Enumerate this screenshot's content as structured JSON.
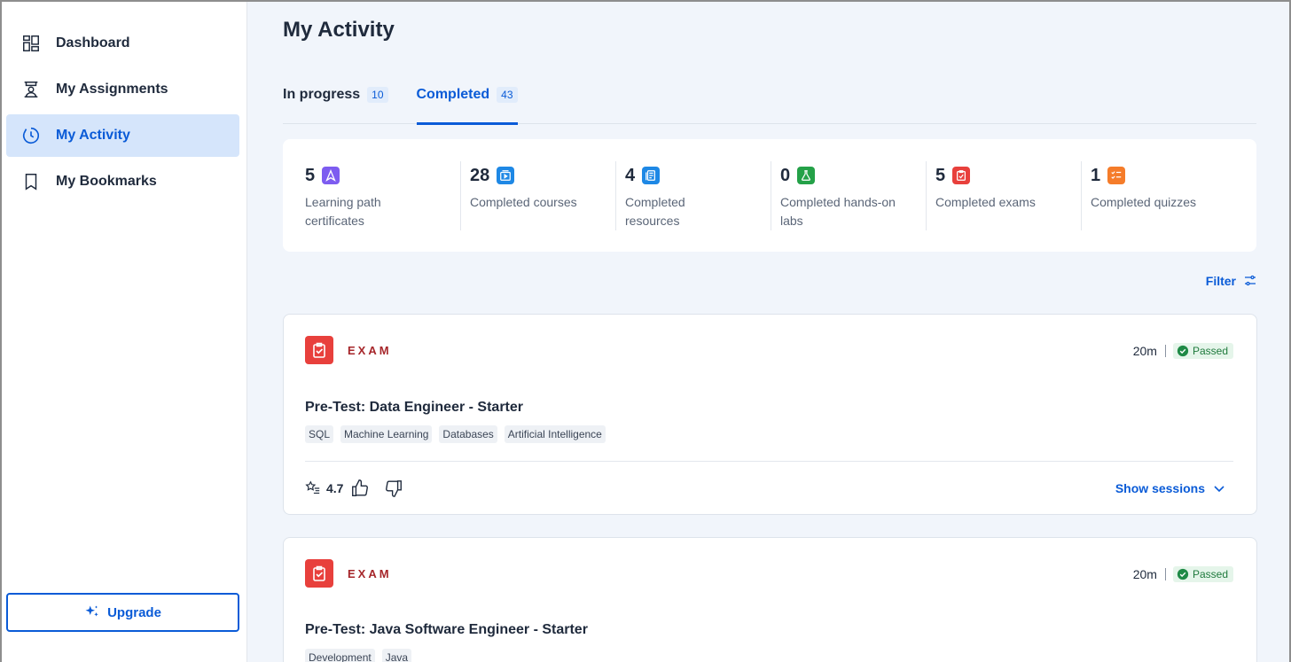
{
  "sidebar": {
    "items": [
      {
        "label": "Dashboard",
        "icon": "dashboard-icon",
        "active": false
      },
      {
        "label": "My Assignments",
        "icon": "assignments-icon",
        "active": false
      },
      {
        "label": "My Activity",
        "icon": "activity-icon",
        "active": true
      },
      {
        "label": "My Bookmarks",
        "icon": "bookmark-icon",
        "active": false
      }
    ],
    "upgrade_label": "Upgrade"
  },
  "main": {
    "title": "My Activity",
    "tabs": [
      {
        "label": "In progress",
        "count": "10",
        "active": false
      },
      {
        "label": "Completed",
        "count": "43",
        "active": true
      }
    ],
    "stats": [
      {
        "value": "5",
        "label": "Learning path certificates",
        "icon": "learning-path-icon",
        "color": "#7d5cf0"
      },
      {
        "value": "28",
        "label": "Completed courses",
        "icon": "course-icon",
        "color": "#1e88e5"
      },
      {
        "value": "4",
        "label": "Completed resources",
        "icon": "resource-icon",
        "color": "#1e88e5"
      },
      {
        "value": "0",
        "label": "Completed hands-on labs",
        "icon": "lab-icon",
        "color": "#24a148"
      },
      {
        "value": "5",
        "label": "Completed exams",
        "icon": "exam-icon",
        "color": "#e8403c"
      },
      {
        "value": "1",
        "label": "Completed quizzes",
        "icon": "quiz-icon",
        "color": "#f57c2a"
      }
    ],
    "filter_label": "Filter",
    "cards": [
      {
        "type": "EXAM",
        "duration": "20m",
        "status": "Passed",
        "title": "Pre-Test: Data Engineer - Starter",
        "tags": [
          "SQL",
          "Machine Learning",
          "Databases",
          "Artificial Intelligence"
        ],
        "rating": "4.7",
        "show_sessions": "Show sessions"
      },
      {
        "type": "EXAM",
        "duration": "20m",
        "status": "Passed",
        "title": "Pre-Test: Java Software Engineer - Starter",
        "tags": [
          "Development",
          "Java"
        ]
      }
    ]
  },
  "colors": {
    "accent": "#0a5bd7",
    "exam_red": "#e8403c",
    "passed_green": "#1f7a3d"
  }
}
